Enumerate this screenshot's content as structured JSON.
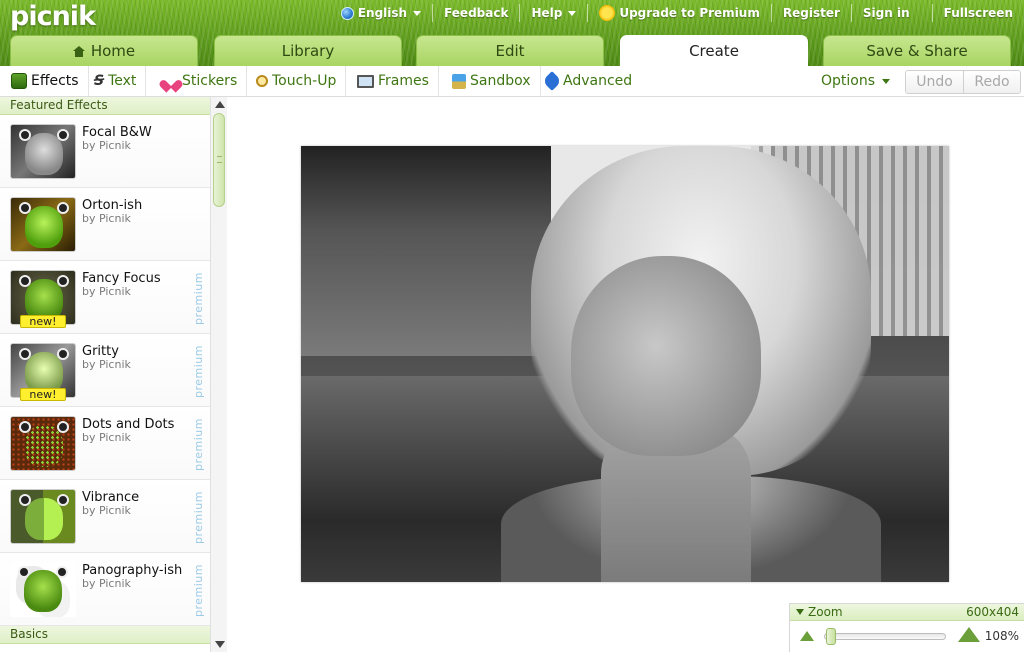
{
  "app": {
    "logo": "picnik"
  },
  "toplinks": {
    "language": "English",
    "feedback": "Feedback",
    "help": "Help",
    "upgrade": "Upgrade to Premium",
    "register": "Register",
    "signin": "Sign in",
    "fullscreen": "Fullscreen"
  },
  "tabs": [
    {
      "label": "Home",
      "icon": "home-icon"
    },
    {
      "label": "Library"
    },
    {
      "label": "Edit"
    },
    {
      "label": "Create",
      "active": true
    },
    {
      "label": "Save & Share"
    }
  ],
  "subtools": [
    {
      "label": "Effects",
      "active": true,
      "icon": "effects-icon"
    },
    {
      "label": "Text",
      "icon": "text-icon"
    },
    {
      "label": "Stickers",
      "icon": "heart-icon"
    },
    {
      "label": "Touch-Up",
      "icon": "magnifier-icon"
    },
    {
      "label": "Frames",
      "icon": "frame-icon"
    },
    {
      "label": "Sandbox",
      "icon": "sandbox-icon"
    },
    {
      "label": "Advanced",
      "icon": "pin-icon"
    }
  ],
  "toolbar": {
    "options": "Options",
    "undo": "Undo",
    "redo": "Redo"
  },
  "panel": {
    "featured_heading": "Featured Effects",
    "basics_heading": "Basics",
    "premium_label": "premium",
    "new_label": "new!",
    "effects": [
      {
        "name": "Focal B&W",
        "by": "by Picnik",
        "premium": false,
        "new": false
      },
      {
        "name": "Orton-ish",
        "by": "by Picnik",
        "premium": false,
        "new": false
      },
      {
        "name": "Fancy Focus",
        "by": "by Picnik",
        "premium": true,
        "new": true
      },
      {
        "name": "Gritty",
        "by": "by Picnik",
        "premium": true,
        "new": true
      },
      {
        "name": "Dots and Dots",
        "by": "by Picnik",
        "premium": true,
        "new": false
      },
      {
        "name": "Vibrance",
        "by": "by Picnik",
        "premium": true,
        "new": false
      },
      {
        "name": "Panography-ish",
        "by": "by Picnik",
        "premium": true,
        "new": false
      }
    ]
  },
  "zoom": {
    "label": "Zoom",
    "dimensions": "600x404",
    "percent": "108%"
  },
  "colors": {
    "brand_green": "#5f9c1d",
    "link_green": "#3e7612",
    "premium_blue": "#9ccbe8",
    "new_yellow": "#ffef2e"
  }
}
